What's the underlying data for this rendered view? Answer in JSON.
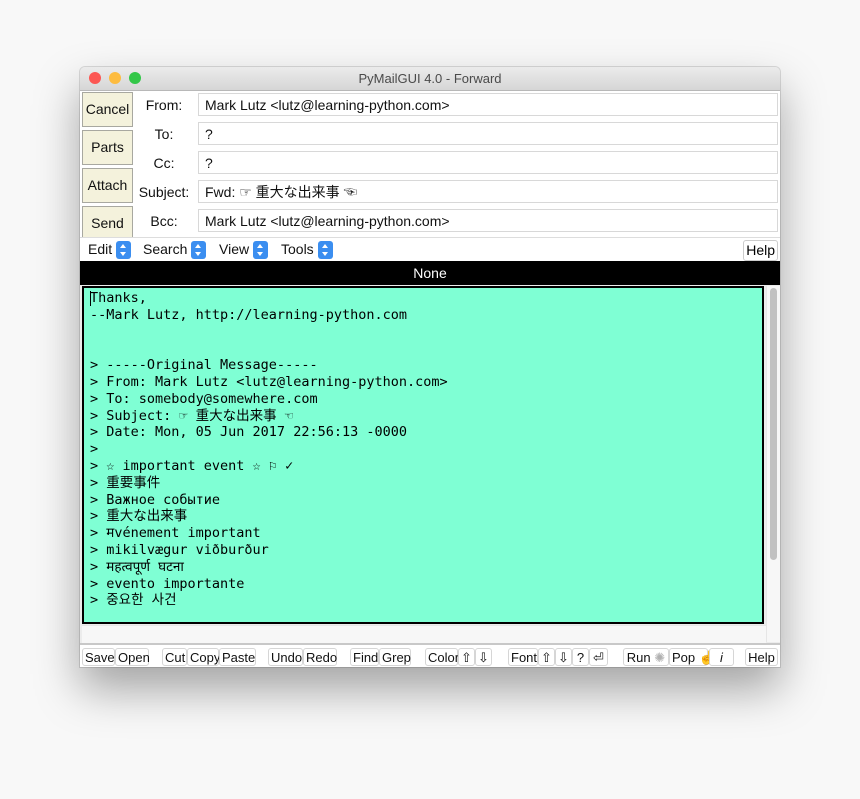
{
  "window": {
    "title": "PyMailGUI 4.0 - Forward",
    "traffic_lights": {
      "close": "#fc5753",
      "minimize": "#fdbc40",
      "zoom": "#33c748"
    }
  },
  "side_buttons": [
    {
      "label": "Cancel"
    },
    {
      "label": "Parts"
    },
    {
      "label": "Attach"
    },
    {
      "label": "Send"
    }
  ],
  "fields": {
    "from": {
      "label": "From:",
      "value": "Mark Lutz <lutz@learning-python.com>"
    },
    "to": {
      "label": "To:",
      "value": "?"
    },
    "cc": {
      "label": "Cc:",
      "value": "?"
    },
    "subject": {
      "label": "Subject:",
      "value": "Fwd: ☞ 重大な出来事 ☜"
    },
    "bcc": {
      "label": "Bcc:",
      "value": "Mark Lutz <lutz@learning-python.com>"
    }
  },
  "menubar": {
    "menus": [
      {
        "label": "Edit"
      },
      {
        "label": "Search"
      },
      {
        "label": "View"
      },
      {
        "label": "Tools"
      }
    ],
    "help_label": "Help"
  },
  "status": {
    "text": "None"
  },
  "body": {
    "background": "#7fffd4",
    "lines": [
      "Thanks,",
      "--Mark Lutz, http://learning-python.com",
      "",
      "",
      "> -----Original Message-----",
      "> From: Mark Lutz <lutz@learning-python.com>",
      "> To: somebody@somewhere.com",
      "> Subject: ☞ 重大な出来事 ☜",
      "> Date: Mon, 05 Jun 2017 22:56:13 -0000",
      ">",
      "> ☆ important event ☆ ⚐ ✓",
      "> 重要事件",
      "> Важное событие",
      "> 重大な出来事",
      "> मvénement important",
      "> mikilvægur viðburður",
      "> महत्वपूर्ण घटना",
      "> evento importante",
      "> 중요한 사건"
    ]
  },
  "toolbar": {
    "save": "Save",
    "open": "Open",
    "cut": "Cut",
    "copy": "Copy",
    "paste": "Paste",
    "undo": "Undo",
    "redo": "Redo",
    "find": "Find",
    "grep": "Grep",
    "color": "Color",
    "color_up": "⇧",
    "color_down": "⇩",
    "font": "Font",
    "font_up": "⇧",
    "font_down": "⇩",
    "font_help": "?",
    "font_return": "⏎",
    "run": "Run",
    "run_icon": "✺",
    "pop": "Pop",
    "pop_icon": "☝",
    "info": "i",
    "help": "Help"
  }
}
